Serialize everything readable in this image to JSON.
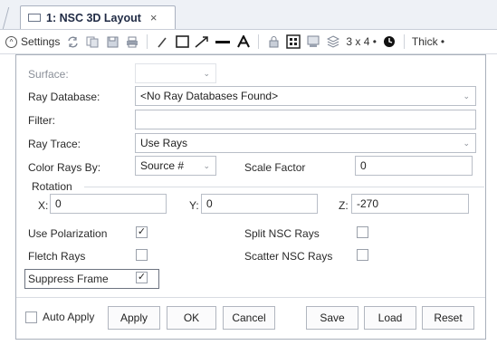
{
  "tab": {
    "title": "1: NSC 3D Layout",
    "close": "×"
  },
  "toolbar": {
    "settings_label": "Settings",
    "icons": [
      "refresh-icon",
      "copy-icon",
      "save-icon",
      "print-icon",
      "pencil-icon",
      "rectangle-icon",
      "arrow-icon",
      "line-icon",
      "text-icon",
      "lock-icon",
      "grid-icon",
      "export-icon",
      "layers-icon"
    ],
    "layout_label": "3 x 4 •",
    "line_label": "Thick •"
  },
  "form": {
    "surface_label": "Surface:",
    "ray_database_label": "Ray Database:",
    "ray_database_value": "<No Ray Databases Found>",
    "filter_label": "Filter:",
    "filter_value": "",
    "ray_trace_label": "Ray Trace:",
    "ray_trace_value": "Use Rays",
    "color_rays_label": "Color Rays By:",
    "color_rays_value": "Source #",
    "scale_factor_label": "Scale Factor",
    "scale_factor_value": "0",
    "rotation_label": "Rotation",
    "rot_x_label": "X:",
    "rot_x_value": "0",
    "rot_y_label": "Y:",
    "rot_y_value": "0",
    "rot_z_label": "Z:",
    "rot_z_value": "-270",
    "use_polarization_label": "Use Polarization",
    "use_polarization_checked": true,
    "split_nsc_label": "Split NSC Rays",
    "split_nsc_checked": false,
    "fletch_rays_label": "Fletch Rays",
    "fletch_rays_checked": false,
    "scatter_nsc_label": "Scatter NSC Rays",
    "scatter_nsc_checked": false,
    "suppress_frame_label": "Suppress Frame",
    "suppress_frame_checked": true,
    "check_mark": "✓"
  },
  "buttons": {
    "auto_apply_label": "Auto Apply",
    "apply": "Apply",
    "ok": "OK",
    "cancel": "Cancel",
    "save": "Save",
    "load": "Load",
    "reset": "Reset"
  }
}
